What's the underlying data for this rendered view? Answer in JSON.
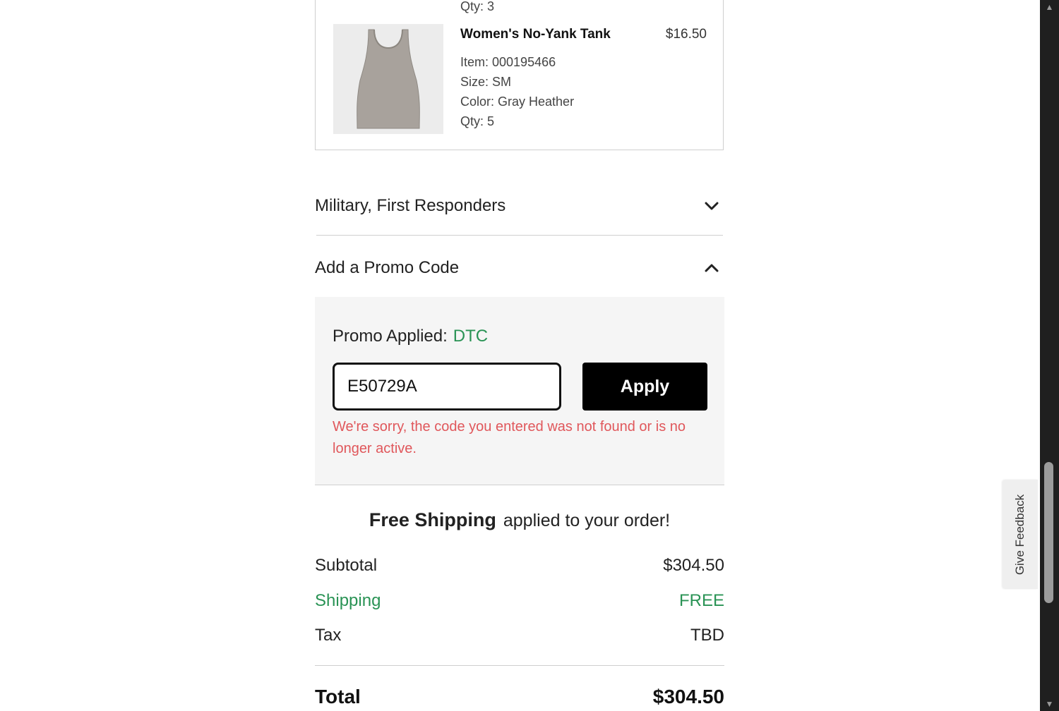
{
  "product": {
    "previous_qty": "Qty: 3",
    "name": "Women's No-Yank Tank",
    "price": "$16.50",
    "item": "Item: 000195466",
    "size": "Size: SM",
    "color": "Color: Gray Heather",
    "qty": "Qty: 5",
    "image_color": "#a8a29c"
  },
  "accordions": {
    "military": {
      "label": "Military, First Responders",
      "icon": "chevron-down-icon"
    },
    "promo": {
      "label": "Add a Promo Code",
      "icon": "chevron-up-icon"
    }
  },
  "promo": {
    "applied_label": "Promo Applied:",
    "applied_code": "DTC",
    "input_value": "E50729A",
    "apply_label": "Apply",
    "error": "We're sorry, the code you entered was not found or is no longer active."
  },
  "free_shipping": {
    "strong": "Free Shipping",
    "text": "applied to your order!"
  },
  "summary": {
    "subtotal_label": "Subtotal",
    "subtotal_value": "$304.50",
    "shipping_label": "Shipping",
    "shipping_value": "FREE",
    "tax_label": "Tax",
    "tax_value": "TBD",
    "total_label": "Total",
    "total_value": "$304.50"
  },
  "feedback": {
    "label": "Give Feedback"
  },
  "colors": {
    "accent_green": "#2a9355",
    "error_red": "#e0575b"
  }
}
